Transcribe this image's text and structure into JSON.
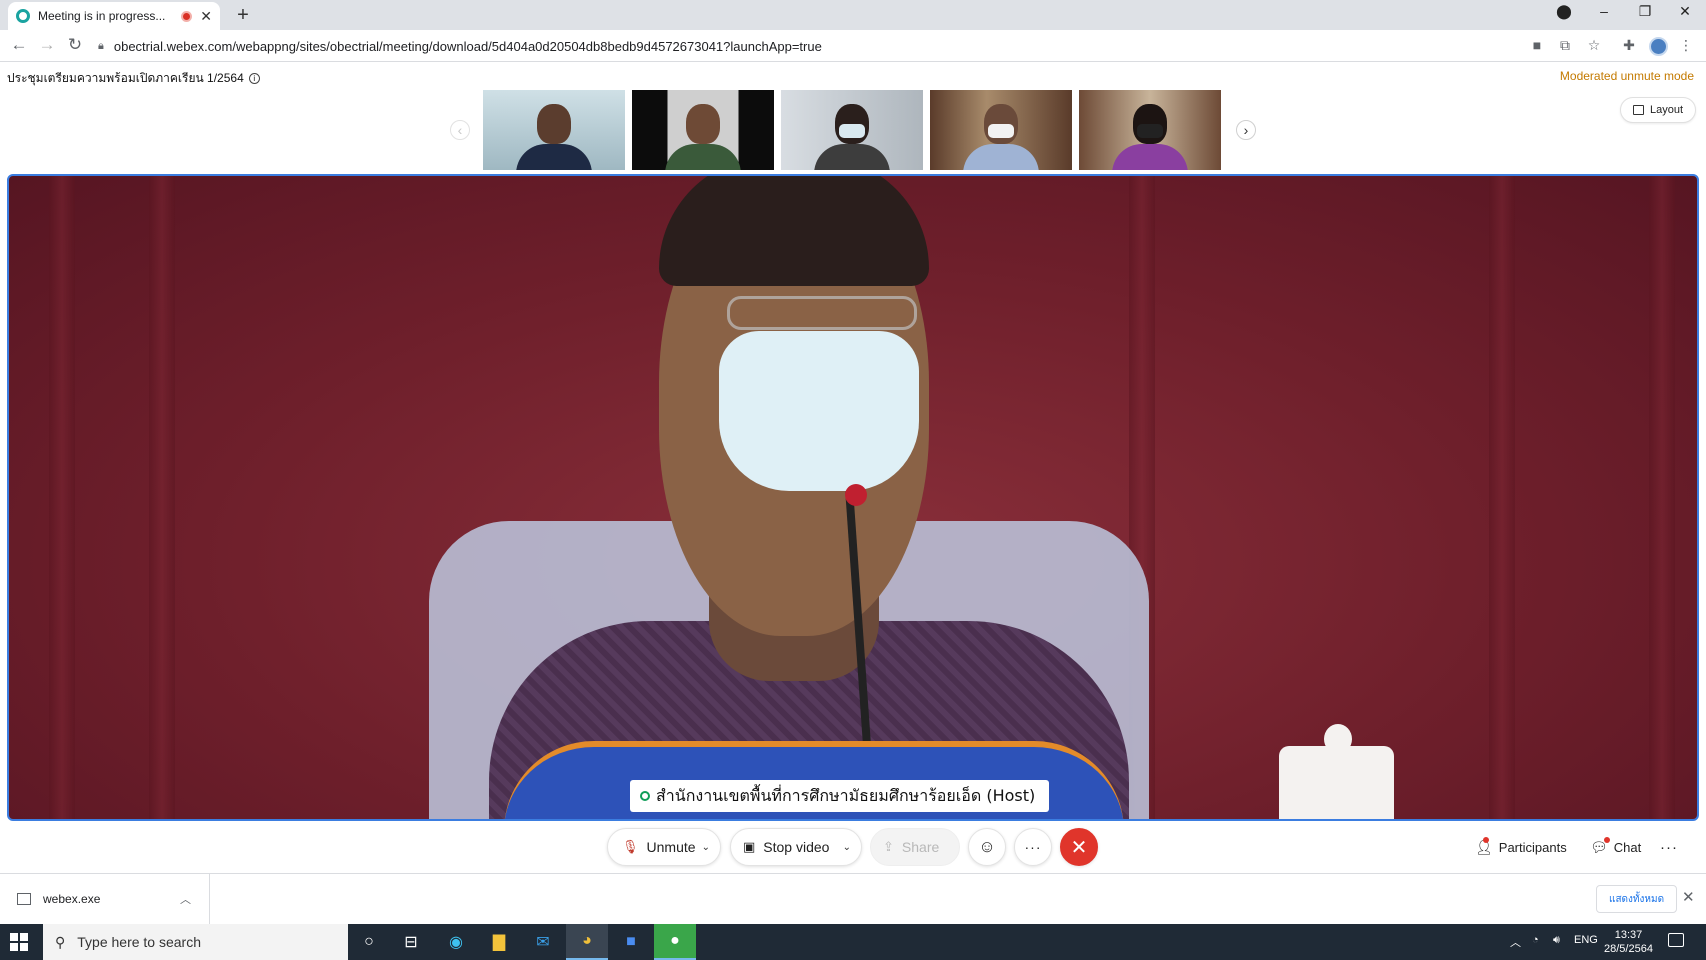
{
  "browser": {
    "tab_title": "Meeting is in progress...",
    "url": "obectrial.webex.com/webappng/sites/obectrial/meeting/download/5d404a0d20504db8bedb9d4572673041?launchApp=true"
  },
  "meeting": {
    "title": "ประชุมเตรียมความพร้อมเปิดภาคเรียน 1/2564",
    "unmute_mode": "Moderated unmute mode",
    "layout_label": "Layout",
    "active_speaker_label": "สำนักงานเขตพื้นที่การศึกษามัธยมศึกษาร้อยเอ็ด (Host)"
  },
  "controls": {
    "unmute_label": "Unmute",
    "stop_video_label": "Stop video",
    "share_label": "Share",
    "participants_label": "Participants",
    "chat_label": "Chat"
  },
  "downloads": {
    "file_name": "webex.exe",
    "show_all_label": "แสดงทั้งหมด"
  },
  "taskbar": {
    "search_placeholder": "Type here to search",
    "language": "ENG",
    "time": "13:37",
    "date": "28/5/2564"
  },
  "colors": {
    "accent": "#3b7de0",
    "end_call": "#e0352b",
    "moderated": "#c47a00"
  }
}
